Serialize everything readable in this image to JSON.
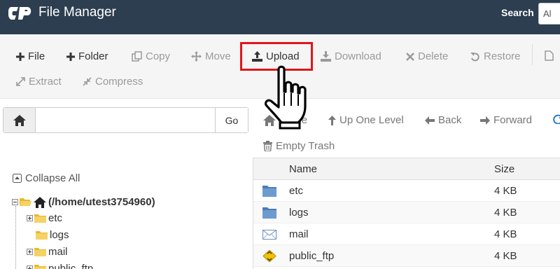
{
  "header": {
    "app_title": "File Manager",
    "search_label": "Search",
    "search_select_value": "Al"
  },
  "toolbar": {
    "row1": [
      {
        "label": "File",
        "icon": "plus-icon",
        "state": "enabled"
      },
      {
        "label": "Folder",
        "icon": "plus-icon",
        "state": "enabled"
      },
      {
        "label": "Copy",
        "icon": "copy-icon",
        "state": "disabled"
      },
      {
        "label": "Move",
        "icon": "move-icon",
        "state": "disabled"
      },
      {
        "label": "Upload",
        "icon": "upload-icon",
        "state": "enabled",
        "highlighted": true
      },
      {
        "label": "Download",
        "icon": "download-icon",
        "state": "disabled"
      },
      {
        "label": "Delete",
        "icon": "times-icon",
        "state": "disabled"
      },
      {
        "label": "Restore",
        "icon": "undo-icon",
        "state": "disabled"
      }
    ],
    "row2": [
      {
        "label": "Extract",
        "icon": "expand-icon",
        "state": "disabled"
      },
      {
        "label": "Compress",
        "icon": "compress-icon",
        "state": "disabled"
      }
    ]
  },
  "path_bar": {
    "input_value": "",
    "go_label": "Go"
  },
  "nav": {
    "home_label": "Home",
    "up_label": "Up One Level",
    "back_label": "Back",
    "forward_label": "Forward",
    "empty_trash_label": "Empty Trash"
  },
  "tree": {
    "collapse_all_label": "Collapse All",
    "root_label": "(/home/utest3754960)",
    "children": [
      {
        "label": "etc",
        "expandable": true
      },
      {
        "label": "logs",
        "expandable": false
      },
      {
        "label": "mail",
        "expandable": true
      },
      {
        "label": "public_ftp",
        "expandable": true
      }
    ]
  },
  "table": {
    "columns": [
      "Name",
      "Size"
    ],
    "rows": [
      {
        "name": "etc",
        "size": "4 KB",
        "icon": "folder-icon"
      },
      {
        "name": "logs",
        "size": "4 KB",
        "icon": "folder-icon"
      },
      {
        "name": "mail",
        "size": "4 KB",
        "icon": "mail-icon"
      },
      {
        "name": "public_ftp",
        "size": "4 KB",
        "icon": "ftp-icon"
      }
    ]
  },
  "colors": {
    "header_bg": "#2d3e50",
    "highlight": "#e0161d",
    "folder_blue": "#5b8fc7",
    "folder_yellow": "#f0c040"
  }
}
